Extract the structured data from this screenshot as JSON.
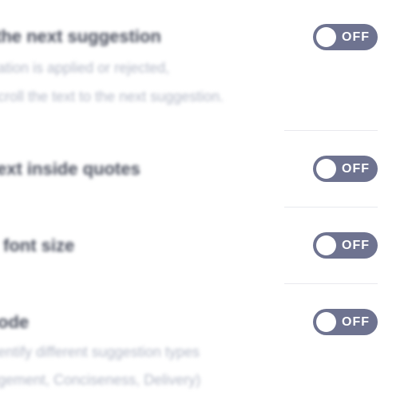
{
  "settings": [
    {
      "title": "the next suggestion",
      "description_lines": [
        "ation is applied or rejected,",
        "croll the text to the next suggestion."
      ],
      "toggle_state": "OFF"
    },
    {
      "title": "ext inside quotes",
      "description_lines": [],
      "toggle_state": "OFF"
    },
    {
      "title": "font size",
      "description_lines": [],
      "toggle_state": "OFF"
    },
    {
      "title": "ode",
      "description_lines": [
        "entify different suggestion types",
        "gement, Conciseness, Delivery)"
      ],
      "toggle_state": "OFF"
    }
  ]
}
